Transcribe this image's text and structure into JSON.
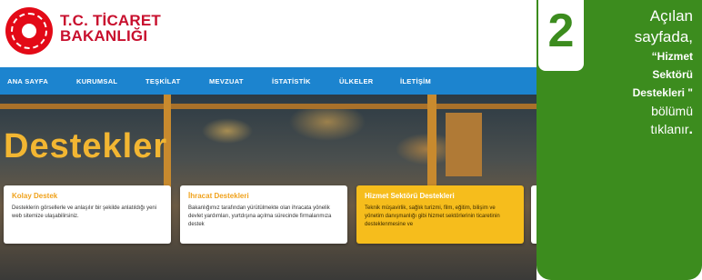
{
  "site": {
    "brand_line1": "T.C. TİCARET",
    "brand_line2": "BAKANLIĞI",
    "logo_icon": "ministry-emblem-icon"
  },
  "nav": {
    "items": [
      "ANA SAYFA",
      "KURUMSAL",
      "TEŞKİLAT",
      "MEVZUAT",
      "İSTATİSTİK",
      "ÜLKELER",
      "İLETİŞİM"
    ]
  },
  "hero": {
    "title": "Destekler"
  },
  "cards": [
    {
      "title": "Kolay Destek",
      "text": "Desteklerin görsellerle ve anlaşılır bir şekilde anlatıldığı yeni web sitemize ulaşabilirsiniz."
    },
    {
      "title": "İhracat Destekleri",
      "text": "Bakanlığımız tarafından yürütülmekte olan ihracata yönelik devlet yardımları, yurtdışına açılma sürecinde firmalarımıza destek"
    },
    {
      "title": "Hizmet Sektörü Destekleri",
      "text": "Teknik müşavirlik, sağlık turizmi, film, eğitim, bilişim ve yönetim danışmanlığı gibi hizmet sektörlerinin ticaretinin desteklenmesine ve"
    }
  ],
  "step": {
    "number": "2",
    "line1": "Açılan",
    "line2": "sayfada,",
    "bold1": "“Hizmet",
    "bold2": "Sektörü",
    "bold3": "Destekleri \"",
    "line3": "bölümü",
    "line4": "tıklanır",
    "period": "."
  },
  "colors": {
    "brand_red": "#c8102e",
    "nav_blue": "#1c84cf",
    "hero_title": "#f2b632",
    "highlight_card": "#f6bd1c",
    "panel_green": "#3c8c1e"
  }
}
